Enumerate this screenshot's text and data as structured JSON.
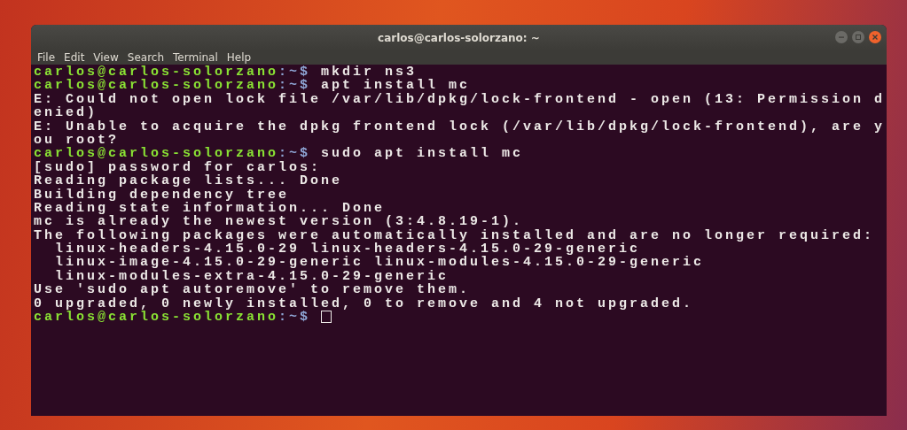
{
  "window": {
    "title": "carlos@carlos-solorzano: ~"
  },
  "menu": [
    "File",
    "Edit",
    "View",
    "Search",
    "Terminal",
    "Help"
  ],
  "lines": [
    {
      "kind": "prompt",
      "user_host": "carlos@carlos-solorzano",
      "path": ":~$",
      "command": "mkdir ns3",
      "cursor": false
    },
    {
      "kind": "prompt",
      "user_host": "carlos@carlos-solorzano",
      "path": ":~$",
      "command": "apt install mc",
      "cursor": false
    },
    {
      "kind": "output",
      "text": "E: Could not open lock file /var/lib/dpkg/lock-frontend - open (13: Permission d"
    },
    {
      "kind": "output",
      "text": "enied)"
    },
    {
      "kind": "output",
      "text": "E: Unable to acquire the dpkg frontend lock (/var/lib/dpkg/lock-frontend), are y"
    },
    {
      "kind": "output",
      "text": "ou root?"
    },
    {
      "kind": "prompt",
      "user_host": "carlos@carlos-solorzano",
      "path": ":~$",
      "command": "sudo apt install mc",
      "cursor": false
    },
    {
      "kind": "output",
      "text": "[sudo] password for carlos:"
    },
    {
      "kind": "output",
      "text": "Reading package lists... Done"
    },
    {
      "kind": "output",
      "text": "Building dependency tree"
    },
    {
      "kind": "output",
      "text": "Reading state information... Done"
    },
    {
      "kind": "output",
      "text": "mc is already the newest version (3:4.8.19-1)."
    },
    {
      "kind": "output",
      "text": "The following packages were automatically installed and are no longer required:"
    },
    {
      "kind": "output",
      "text": "  linux-headers-4.15.0-29 linux-headers-4.15.0-29-generic"
    },
    {
      "kind": "output",
      "text": "  linux-image-4.15.0-29-generic linux-modules-4.15.0-29-generic"
    },
    {
      "kind": "output",
      "text": "  linux-modules-extra-4.15.0-29-generic"
    },
    {
      "kind": "output",
      "text": "Use 'sudo apt autoremove' to remove them."
    },
    {
      "kind": "output",
      "text": "0 upgraded, 0 newly installed, 0 to remove and 4 not upgraded."
    },
    {
      "kind": "prompt",
      "user_host": "carlos@carlos-solorzano",
      "path": ":~$",
      "cursor": true
    }
  ]
}
